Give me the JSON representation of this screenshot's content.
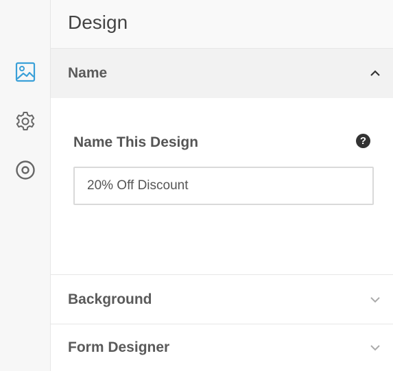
{
  "rail": {
    "items": [
      {
        "icon": "image-icon",
        "active": true
      },
      {
        "icon": "gear-icon",
        "active": false
      },
      {
        "icon": "target-icon",
        "active": false
      }
    ],
    "active_color": "#3aa0d8",
    "inactive_color": "#666666"
  },
  "panel": {
    "title": "Design"
  },
  "sections": {
    "name": {
      "label": "Name",
      "expanded": true,
      "field_label": "Name This Design",
      "help_glyph": "?",
      "input_value": "20% Off Discount"
    },
    "background": {
      "label": "Background",
      "expanded": false
    },
    "form_designer": {
      "label": "Form Designer",
      "expanded": false
    }
  }
}
